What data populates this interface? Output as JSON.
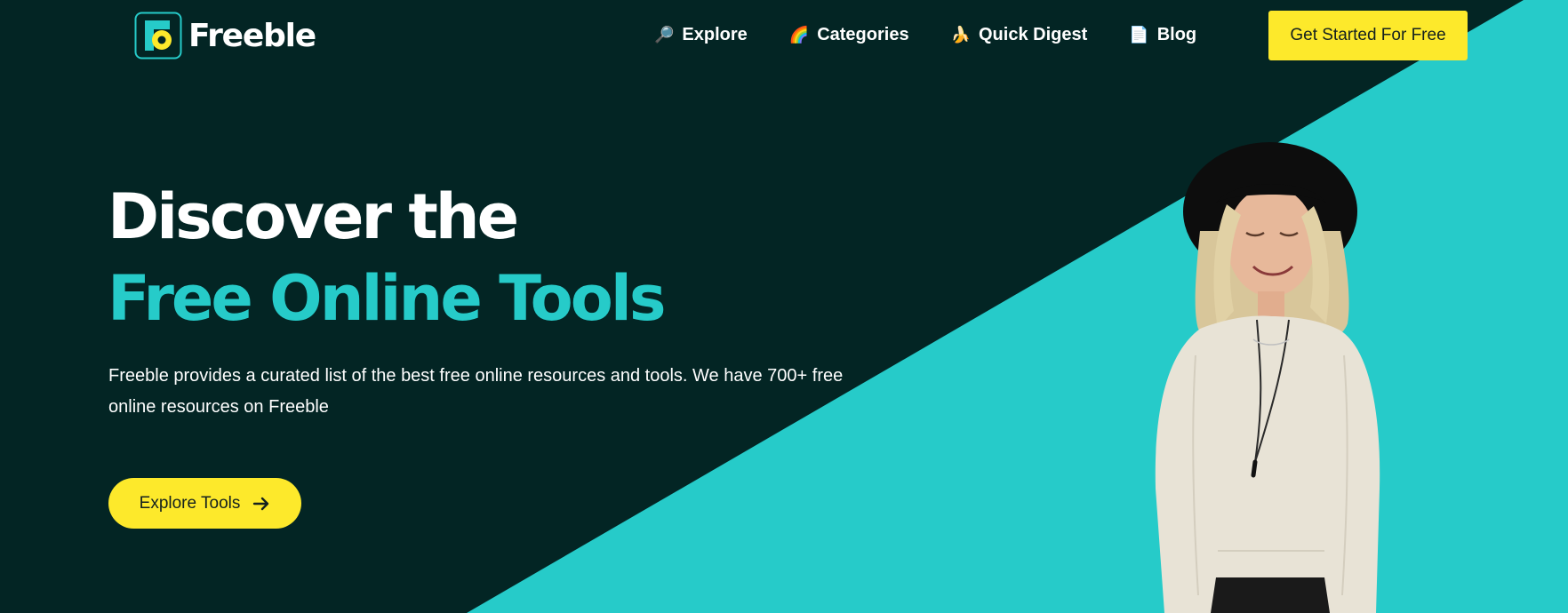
{
  "brand": {
    "name": "Freeble"
  },
  "nav": {
    "items": [
      {
        "label": "Explore",
        "emoji": "🔎"
      },
      {
        "label": "Categories",
        "emoji": "🌈"
      },
      {
        "label": "Quick Digest",
        "emoji": "🍌"
      },
      {
        "label": "Blog",
        "emoji": "📄"
      }
    ],
    "cta_label": "Get Started For Free"
  },
  "hero": {
    "title_line1": "Discover the",
    "title_line2": "Free Online Tools",
    "description": "Freeble provides a curated list of the best free online resources and tools. We have 700+ free online resources on Freeble",
    "button_label": "Explore Tools"
  },
  "colors": {
    "background": "#032524",
    "accent_teal": "#26cbc9",
    "accent_yellow": "#fde92b",
    "text_light": "#ffffff"
  },
  "icons": {
    "logo": "freeble-logo-icon",
    "arrow": "arrow-right-icon"
  }
}
